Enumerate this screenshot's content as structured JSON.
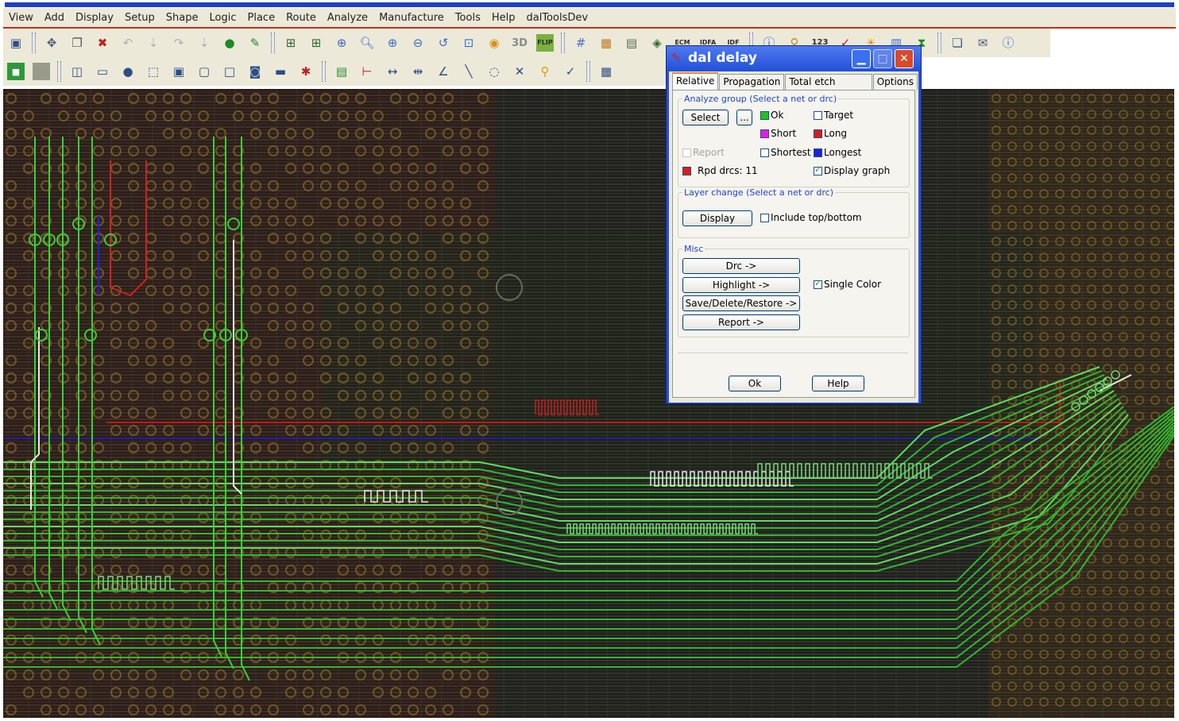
{
  "menu": [
    "View",
    "Add",
    "Display",
    "Setup",
    "Shape",
    "Logic",
    "Place",
    "Route",
    "Analyze",
    "Manufacture",
    "Tools",
    "Help",
    "dalToolsDev"
  ],
  "toolbar1_icons": [
    "save-icon",
    "move-icon",
    "copy-icon",
    "delete-icon",
    "undo-icon",
    "undo-list-icon",
    "redo-icon",
    "redo-list-icon",
    "pin-icon",
    "pushpin-icon",
    "grid-icon",
    "grid-fine-icon",
    "zoom-fit-icon",
    "zoom-in-icon",
    "zoom-out-icon",
    "zoom-world-icon",
    "zoom-previous-icon",
    "zoom-center-icon",
    "refresh-icon",
    "3d-view-icon",
    "flip-icon",
    "grid-toggle-icon",
    "color-icon",
    "component-icon",
    "layer-icon",
    "ecm-icon",
    "idfa-icon",
    "idf-icon",
    "help-info-icon",
    "count-icon",
    "measure-icon",
    "star-icon",
    "bar-chart-icon",
    "hourglass-icon",
    "window-icon",
    "mail-icon",
    "help-icon"
  ],
  "toolbar1_labels": {
    "n123": "123",
    "ecm": "ECM",
    "idfa": "IDFA",
    "idf": "IDF",
    "flip": "FLIP",
    "threeD": "3D"
  },
  "toolbar2_icons": [
    "color-green-icon",
    "color-gray-icon",
    "shape-icon",
    "rect-icon",
    "circle-icon",
    "select-icon",
    "polygon-icon",
    "frame-icon",
    "square-icon",
    "circle-square-icon",
    "stack-icon",
    "component-red-icon",
    "chip-icon",
    "dimension-icon",
    "dimension-h-icon",
    "dimension-v-icon",
    "angle-icon",
    "line-icon",
    "arc-icon",
    "cross-icon",
    "zoom-highlight-icon",
    "check-icon",
    "odb-icon",
    "extra-icon"
  ],
  "dialog": {
    "title": "dal delay",
    "tabs": [
      "Relative",
      "Propagation",
      "Total etch length",
      "Options"
    ],
    "analyze_group": {
      "label": "Analyze group (Select a net or drc)",
      "select_button": "Select",
      "more_button": "...",
      "report": "Report",
      "rpd_drcs": "Rpd drcs: 11",
      "legend": [
        {
          "label": "Ok",
          "color": "#22c122"
        },
        {
          "label": "Target",
          "color": "#ffffff"
        },
        {
          "label": "Short",
          "color": "#e21ee2"
        },
        {
          "label": "Long",
          "color": "#e01a1a"
        },
        {
          "label": "Shortest",
          "color": "#ffffff"
        },
        {
          "label": "Longest",
          "color": "#1d22d8"
        }
      ],
      "display_graph": "Display graph"
    },
    "layer_change": {
      "label": "Layer change (Select a net or drc)",
      "display_button": "Display",
      "include_topbottom": "Include top/bottom"
    },
    "misc": {
      "label": "Misc",
      "drc_button": "Drc ->",
      "highlight_button": "Highlight ->",
      "save_button": "Save/Delete/Restore ->",
      "report_button": "Report ->",
      "single_color": "Single Color"
    },
    "ok_button": "Ok",
    "help_button": "Help"
  }
}
